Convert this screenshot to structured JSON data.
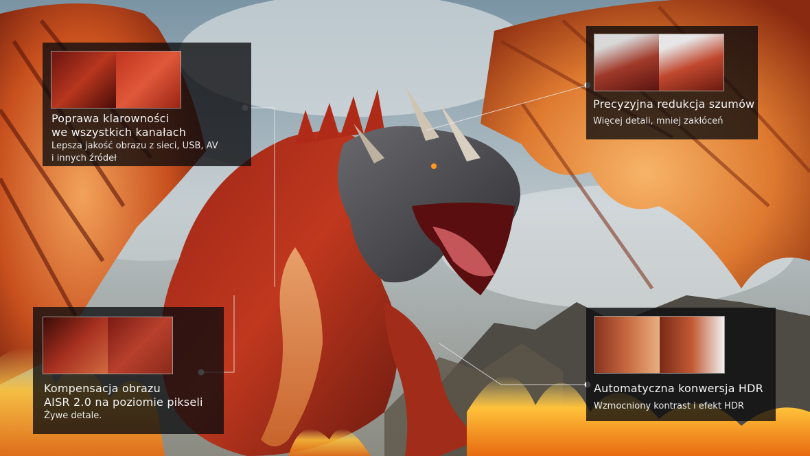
{
  "colors": {
    "sky": "#5f7a88",
    "dragon_red": "#b8301c",
    "wing_orange": "#e07a2a",
    "fire": "#ffb21f",
    "panel_bg": "#0c0c0e",
    "connector": "#e6e6e6"
  },
  "features": [
    {
      "id": "clarity",
      "title_line1": "Poprawa klarowności",
      "title_line2": "we wszystkich kanałach",
      "sub_line1": "Lepsza jakość obrazu z sieci, USB, AV",
      "sub_line2": "i innych źródeł"
    },
    {
      "id": "noise",
      "title_line1": "Precyzyjna redukcja szumów",
      "sub_line1": "Więcej detali, mniej zakłóceń"
    },
    {
      "id": "aisr",
      "title_line1": "Kompensacja obrazu",
      "title_line2": "AISR 2.0 na poziomie pikseli",
      "sub_line1": "Żywe detale."
    },
    {
      "id": "hdr",
      "title_line1": "Automatyczna konwersja HDR",
      "sub_line1": "Wzmocniony kontrast i efekt HDR"
    }
  ]
}
